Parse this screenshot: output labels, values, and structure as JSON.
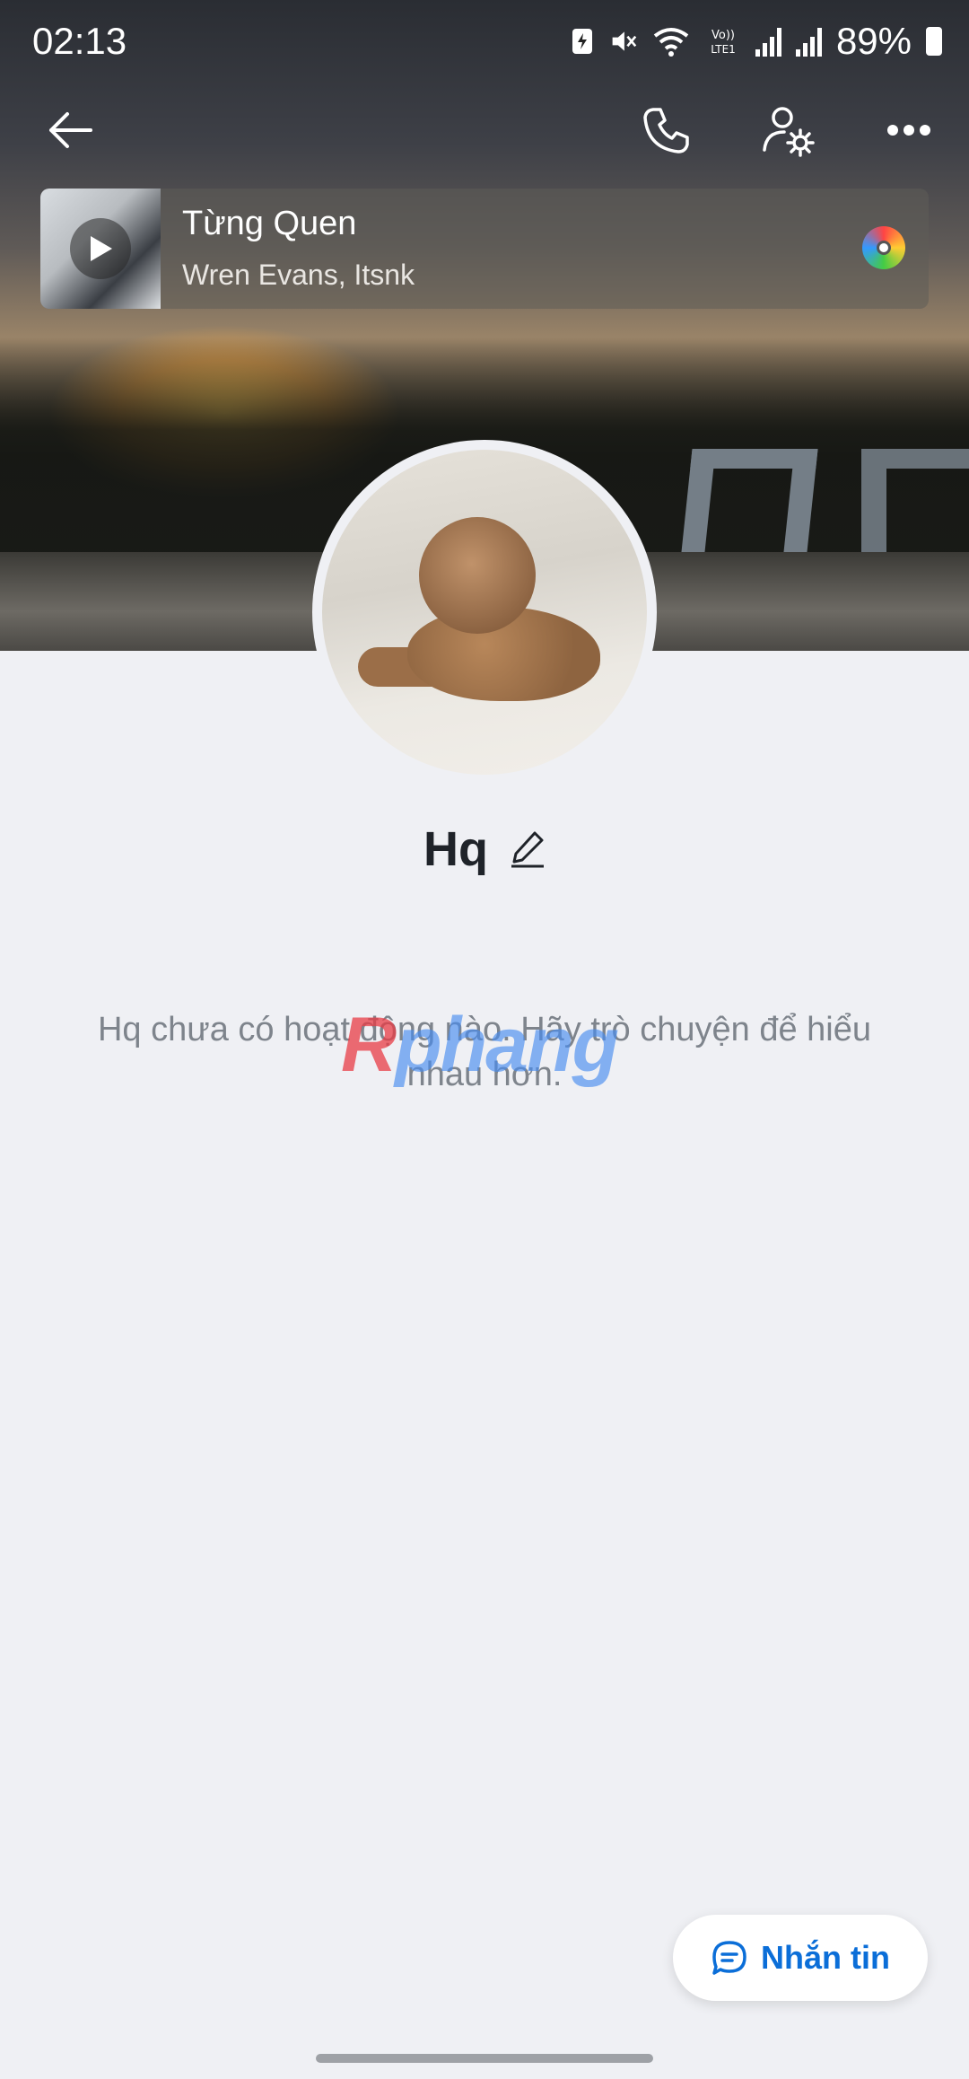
{
  "status_bar": {
    "time": "02:13",
    "battery": "89%",
    "icons": [
      "battery-saver-icon",
      "mute-icon",
      "wifi-icon",
      "volte-icon",
      "signal-icon",
      "signal-icon",
      "battery-icon"
    ]
  },
  "header": {
    "back_icon": "back-arrow-icon",
    "call_icon": "phone-icon",
    "settings_icon": "user-settings-icon",
    "more_icon": "more-icon"
  },
  "music": {
    "title": "Từng Quen",
    "artist": "Wren Evans, Itsnk"
  },
  "profile": {
    "name": "Hq",
    "empty_message": "Hq chưa có hoạt động nào. Hãy trò chuyện để hiểu nhau hơn."
  },
  "watermark": {
    "first": "R",
    "rest": "phang"
  },
  "actions": {
    "message_label": "Nhắn tin"
  },
  "colors": {
    "background": "#eff0f4",
    "accent": "#0b6ed8",
    "text": "#1f2329",
    "muted": "#7e848c"
  }
}
